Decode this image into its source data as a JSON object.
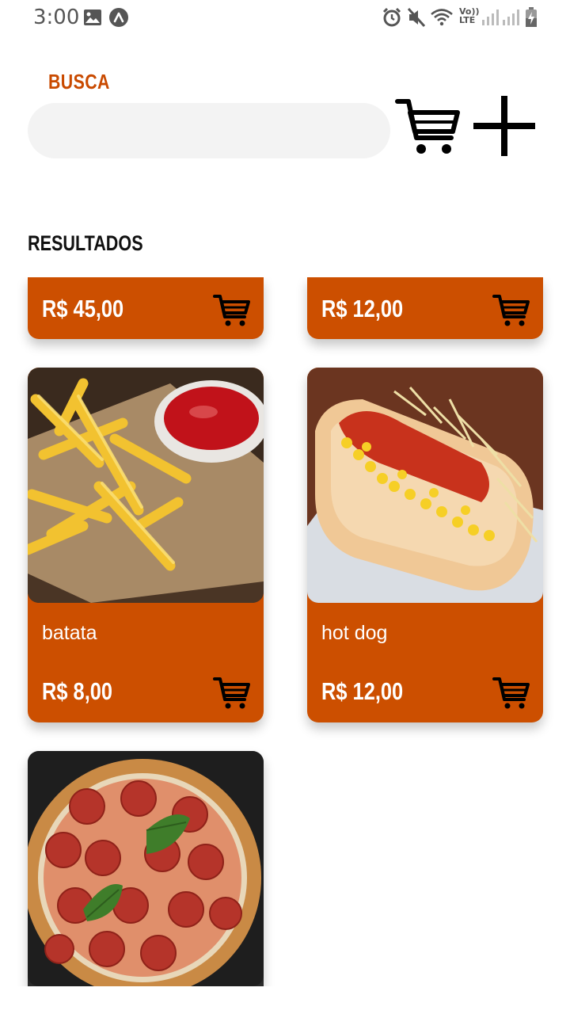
{
  "status_bar": {
    "time": "3:00",
    "icons": [
      "image-icon",
      "app-a-icon",
      "alarm-icon",
      "mute-icon",
      "wifi-icon",
      "volte-icon",
      "signal-icon",
      "signal-icon",
      "battery-charging-icon"
    ],
    "volte_label_top": "Vo))",
    "volte_label_bottom": "LTE"
  },
  "header": {
    "search_label": "BUSCA",
    "search_value": "",
    "cart_icon": "cart-icon",
    "add_icon": "plus-icon"
  },
  "results": {
    "label": "RESULTADOS",
    "items": [
      {
        "name": "",
        "price": "R$ 45,00",
        "image": "",
        "partial": true
      },
      {
        "name": "",
        "price": "R$ 12,00",
        "image": "",
        "partial": true
      },
      {
        "name": "batata",
        "price": "R$ 8,00",
        "image": "fries-photo"
      },
      {
        "name": "hot dog",
        "price": "R$ 12,00",
        "image": "hotdog-photo"
      },
      {
        "name": "",
        "price": "",
        "image": "pizza-photo",
        "partial": true
      }
    ]
  },
  "colors": {
    "accent": "#cc4f00",
    "label_accent": "#c94a00",
    "input_bg": "#f3f3f3"
  }
}
